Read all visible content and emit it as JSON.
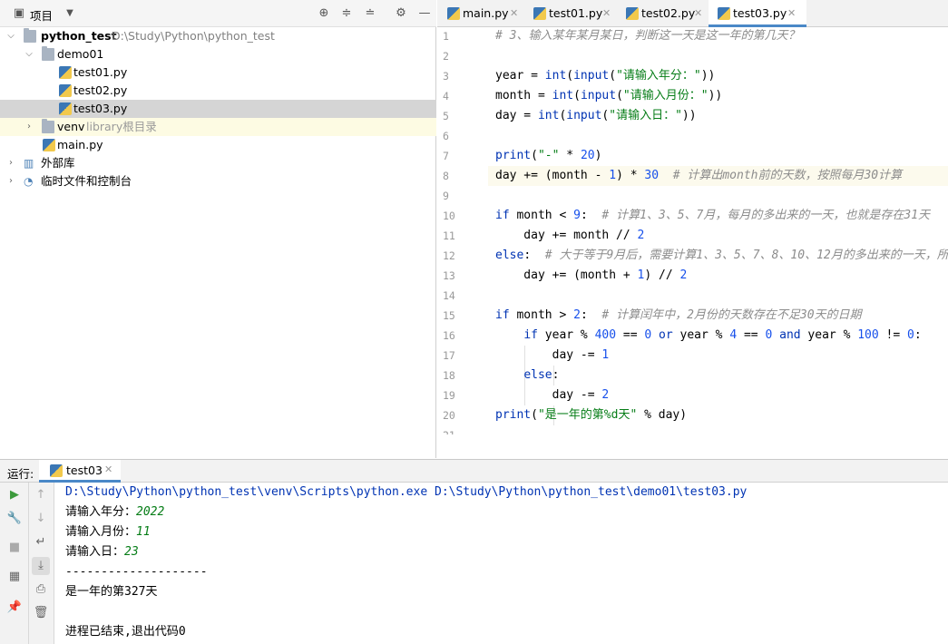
{
  "project_panel": {
    "title": "项目",
    "tree": [
      {
        "label": "python_test",
        "path": "D:\\Study\\Python\\python_test"
      },
      {
        "label": "demo01"
      },
      {
        "label": "test01.py"
      },
      {
        "label": "test02.py"
      },
      {
        "label": "test03.py"
      },
      {
        "label": "venv",
        "note": "library根目录"
      },
      {
        "label": "main.py"
      },
      {
        "label": "外部库"
      },
      {
        "label": "临时文件和控制台"
      }
    ]
  },
  "editor": {
    "tabs": [
      "main.py",
      "test01.py",
      "test02.py",
      "test03.py"
    ],
    "active_tab": "test03.py",
    "line_numbers": [
      "1",
      "2",
      "3",
      "4",
      "5",
      "6",
      "7",
      "8",
      "9",
      "10",
      "11",
      "12",
      "13",
      "14",
      "15",
      "16",
      "17",
      "18",
      "19",
      "20",
      "21"
    ]
  },
  "code": [
    [
      {
        "c": "cm",
        "t": "# 3、输入某年某月某日，判断这一天是这一年的第几天？"
      }
    ],
    [],
    [
      {
        "t": "year = "
      },
      {
        "c": "bi",
        "t": "int"
      },
      {
        "t": "("
      },
      {
        "c": "bi",
        "t": "input"
      },
      {
        "t": "("
      },
      {
        "c": "st",
        "t": "\"请输入年分：\""
      },
      {
        "t": "))"
      }
    ],
    [
      {
        "t": "month = "
      },
      {
        "c": "bi",
        "t": "int"
      },
      {
        "t": "("
      },
      {
        "c": "bi",
        "t": "input"
      },
      {
        "t": "("
      },
      {
        "c": "st",
        "t": "\"请输入月份：\""
      },
      {
        "t": "))"
      }
    ],
    [
      {
        "t": "day = "
      },
      {
        "c": "bi",
        "t": "int"
      },
      {
        "t": "("
      },
      {
        "c": "bi",
        "t": "input"
      },
      {
        "t": "("
      },
      {
        "c": "st",
        "t": "\"请输入日：\""
      },
      {
        "t": "))"
      }
    ],
    [],
    [
      {
        "c": "bi",
        "t": "print"
      },
      {
        "t": "("
      },
      {
        "c": "st",
        "t": "\"-\""
      },
      {
        "t": " * "
      },
      {
        "c": "nm",
        "t": "20"
      },
      {
        "t": ")"
      }
    ],
    [
      {
        "t": "day += (month - "
      },
      {
        "c": "nm",
        "t": "1"
      },
      {
        "t": ") * "
      },
      {
        "c": "nm",
        "t": "30"
      },
      {
        "t": "  "
      },
      {
        "c": "cm",
        "t": "# 计算出month前的天数，按照每月30计算"
      }
    ],
    [],
    [
      {
        "c": "kw",
        "t": "if"
      },
      {
        "t": " month < "
      },
      {
        "c": "nm",
        "t": "9"
      },
      {
        "t": ":  "
      },
      {
        "c": "cm",
        "t": "# 计算1、3、5、7月，每月的多出来的一天，也就是存在31天"
      }
    ],
    [
      {
        "t": "    day += month // "
      },
      {
        "c": "nm",
        "t": "2"
      }
    ],
    [
      {
        "c": "kw",
        "t": "else"
      },
      {
        "t": ":  "
      },
      {
        "c": "cm",
        "t": "# 大于等于9月后，需要计算1、3、5、7、8、10、12月的多出来的一天，所"
      }
    ],
    [
      {
        "t": "    day += (month + "
      },
      {
        "c": "nm",
        "t": "1"
      },
      {
        "t": ") // "
      },
      {
        "c": "nm",
        "t": "2"
      }
    ],
    [],
    [
      {
        "c": "kw",
        "t": "if"
      },
      {
        "t": " month > "
      },
      {
        "c": "nm",
        "t": "2"
      },
      {
        "t": ":  "
      },
      {
        "c": "cm",
        "t": "# 计算闰年中，2月份的天数存在不足30天的日期"
      }
    ],
    [
      {
        "t": "    "
      },
      {
        "c": "kw",
        "t": "if"
      },
      {
        "t": " year % "
      },
      {
        "c": "nm",
        "t": "400"
      },
      {
        "t": " == "
      },
      {
        "c": "nm",
        "t": "0"
      },
      {
        "t": " "
      },
      {
        "c": "kw",
        "t": "or"
      },
      {
        "t": " year % "
      },
      {
        "c": "nm",
        "t": "4"
      },
      {
        "t": " == "
      },
      {
        "c": "nm",
        "t": "0"
      },
      {
        "t": " "
      },
      {
        "c": "kw",
        "t": "and"
      },
      {
        "t": " year % "
      },
      {
        "c": "nm",
        "t": "100"
      },
      {
        "t": " != "
      },
      {
        "c": "nm",
        "t": "0"
      },
      {
        "t": ":"
      }
    ],
    [
      {
        "t": "        day -= "
      },
      {
        "c": "nm",
        "t": "1"
      }
    ],
    [
      {
        "t": "    "
      },
      {
        "c": "kw",
        "t": "else"
      },
      {
        "t": ":"
      }
    ],
    [
      {
        "t": "        day -= "
      },
      {
        "c": "nm",
        "t": "2"
      }
    ],
    [
      {
        "c": "bi",
        "t": "print"
      },
      {
        "t": "("
      },
      {
        "c": "st",
        "t": "\"是一年的第%d天\""
      },
      {
        "t": " % day)"
      }
    ],
    []
  ],
  "run_panel": {
    "label": "运行:",
    "tab": "test03",
    "command": "D:\\Study\\Python\\python_test\\venv\\Scripts\\python.exe D:\\Study\\Python\\python_test\\demo01\\test03.py",
    "prompt_year": "请输入年分：",
    "input_year": "2022",
    "prompt_month": "请输入月份：",
    "input_month": "11",
    "prompt_day": "请输入日：",
    "input_day": "23",
    "separator": "--------------------",
    "result": "是一年的第327天",
    "exit_message": "进程已结束,退出代码0"
  },
  "colors": {
    "keyword": "#0033b3",
    "string": "#067d17",
    "number": "#1750eb",
    "comment": "#8c8c8c",
    "selection": "#d5d5d5",
    "active_tab_underline": "#4a88c7"
  }
}
